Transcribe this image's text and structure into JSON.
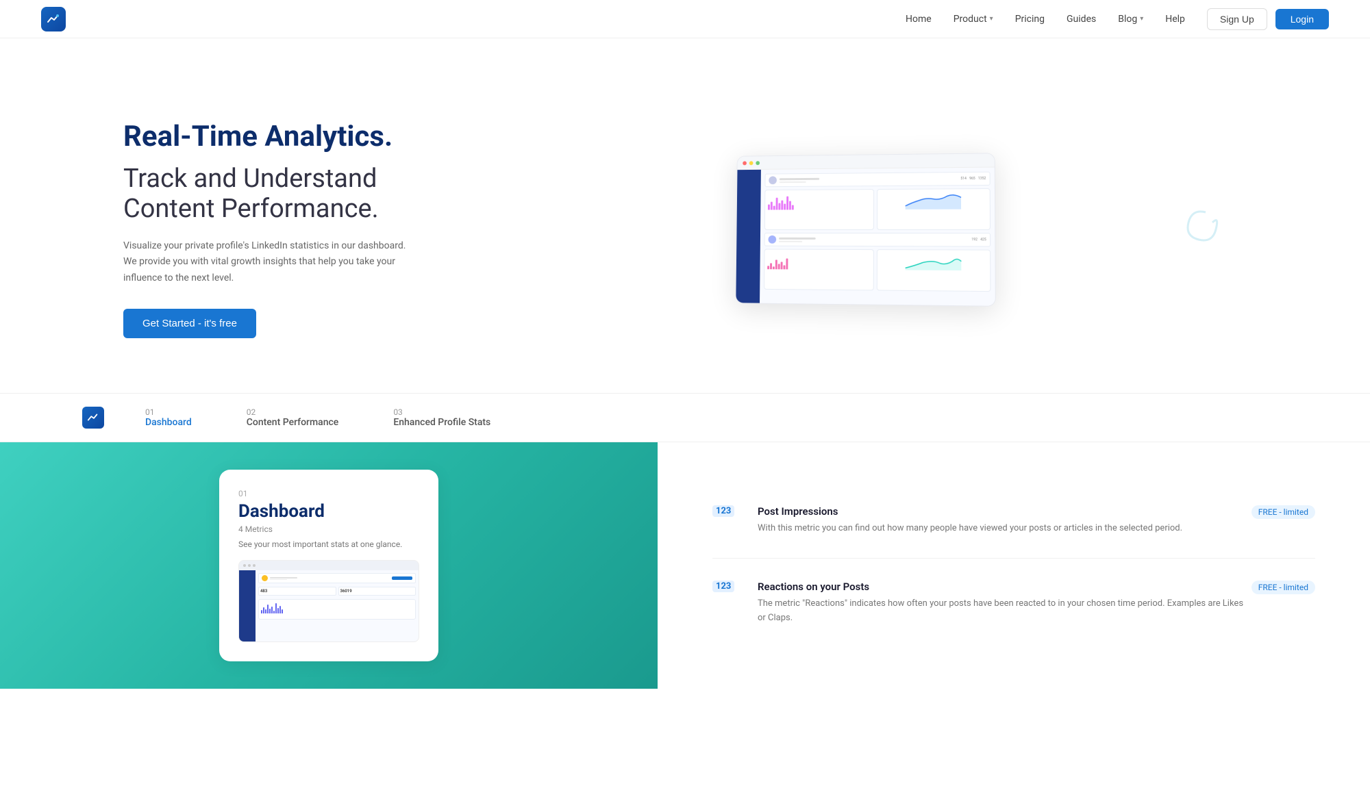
{
  "brand": {
    "logo_symbol": "📈"
  },
  "navbar": {
    "links": [
      {
        "label": "Home",
        "has_dropdown": false
      },
      {
        "label": "Product",
        "has_dropdown": true
      },
      {
        "label": "Pricing",
        "has_dropdown": false
      },
      {
        "label": "Guides",
        "has_dropdown": false
      },
      {
        "label": "Blog",
        "has_dropdown": true
      },
      {
        "label": "Help",
        "has_dropdown": false
      }
    ],
    "signup_label": "Sign Up",
    "login_label": "Login"
  },
  "hero": {
    "title_bold": "Real-Time Analytics.",
    "title_normal_1": "Track and Understand",
    "title_normal_2": "Content Performance.",
    "description": "Visualize your private profile's LinkedIn statistics in our dashboard. We provide you with vital growth insights that help you take your influence to the next level.",
    "cta_label": "Get Started - it's free"
  },
  "section_tabs": {
    "items": [
      {
        "num": "01",
        "label": "Dashboard",
        "active": true
      },
      {
        "num": "02",
        "label": "Content Performance",
        "active": false
      },
      {
        "num": "03",
        "label": "Enhanced Profile Stats",
        "active": false
      }
    ]
  },
  "feature": {
    "card": {
      "num": "01",
      "title": "Dashboard",
      "badge": "4 Metrics",
      "desc": "See your most important stats at one glance."
    },
    "metrics": [
      {
        "badge": "123",
        "title": "Post Impressions",
        "plan": "FREE - limited",
        "desc": "With this metric you can find out how many people have viewed your posts or articles in the selected period."
      },
      {
        "badge": "123",
        "title": "Reactions on your Posts",
        "plan": "FREE - limited",
        "desc": "The metric \"Reactions\" indicates how often your posts have been reacted to in your chosen time period. Examples are Likes or Claps."
      }
    ]
  },
  "colors": {
    "primary_blue": "#1976d2",
    "dark_blue": "#0d2d6b",
    "teal_bg": "#3fd0c0",
    "accent_metric": "#1976d2"
  }
}
